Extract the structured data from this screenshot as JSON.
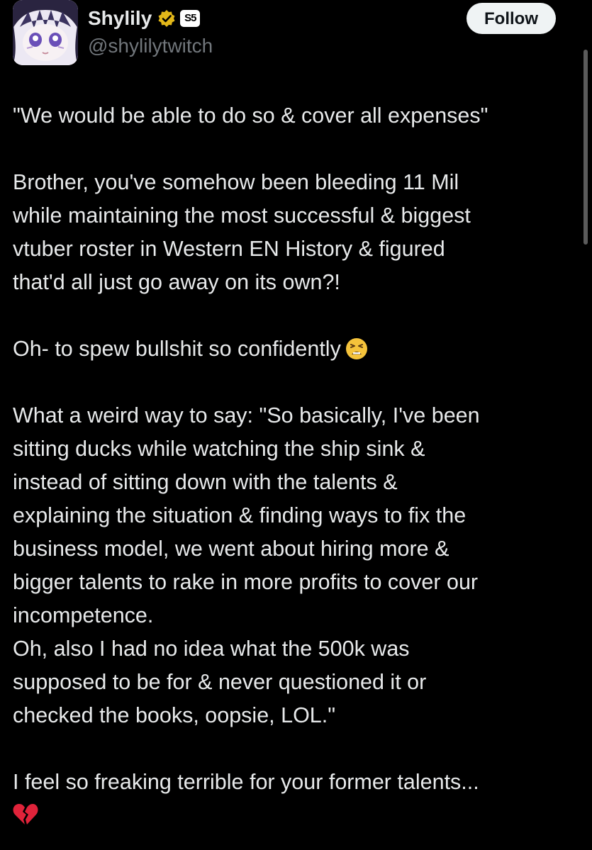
{
  "user": {
    "display_name": "Shylily",
    "handle": "@shylilytwitch",
    "affiliate_badge_text": "S5",
    "avatar_icon": "avatar-image",
    "verified_color": "#e2b719"
  },
  "header": {
    "follow_label": "Follow"
  },
  "tweet": {
    "quote_line": "\"We would be able to do so & cover all expenses\"",
    "para2": [
      "Brother, you've somehow been bleeding 11 Mil",
      "while maintaining the most successful & biggest",
      "vtuber roster in Western EN History & figured",
      "that'd all just go away on its own?!"
    ],
    "para3": "Oh- to spew bullshit so confidently",
    "para3_emoji": "tired-face-emoji",
    "para4": [
      "What a weird way to say: \"So basically, I've been",
      "sitting ducks while watching the ship sink &",
      "instead of sitting down with the talents &",
      "explaining the situation & finding ways to fix the",
      "business model, we went about hiring more &",
      "bigger talents to rake in more profits to cover our",
      "incompetence.",
      "Oh, also I had no idea what the 500k was",
      "supposed to be for & never questioned it or",
      "checked the books, oopsie, LOL.\""
    ],
    "para5": "I feel so freaking terrible for your former talents...",
    "para5_emoji": "broken-heart-emoji"
  },
  "colors": {
    "background": "#000000",
    "text": "#e7e9ea",
    "secondary_text": "#71767b",
    "follow_bg": "#eff3f4"
  }
}
